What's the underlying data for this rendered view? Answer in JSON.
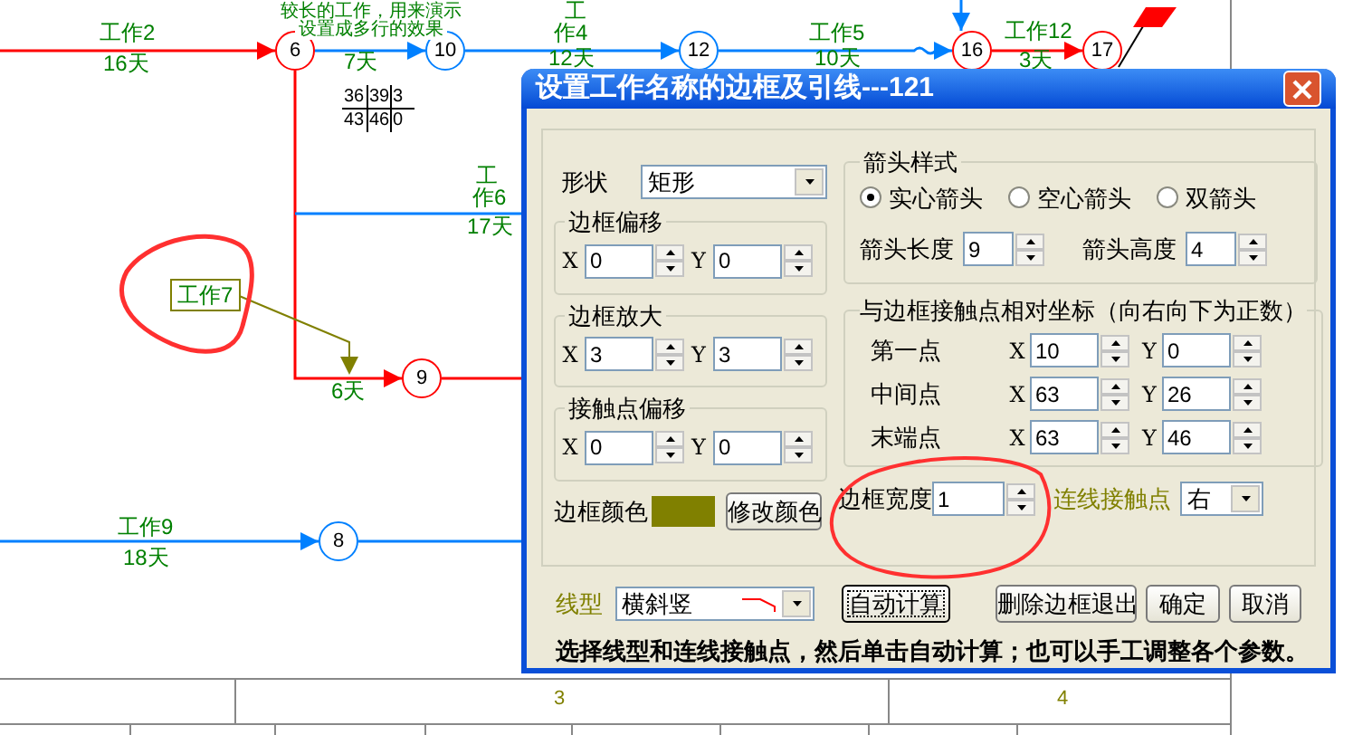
{
  "canvas": {
    "caption": [
      "较长的工作，用来演示",
      "设置成多行的效果"
    ],
    "nodes": [
      {
        "label": "6",
        "color": "#ff0000"
      },
      {
        "label": "10",
        "color": "#0080ff"
      },
      {
        "label": "12",
        "color": "#0080ff"
      },
      {
        "label": "16",
        "color": "#ff0000"
      },
      {
        "label": "17",
        "color": "#ff0000"
      },
      {
        "label": "9",
        "color": "#ff0000"
      },
      {
        "label": "8",
        "color": "#0080ff"
      }
    ],
    "labels": [
      "工作2",
      "16天",
      "7天",
      "工",
      "作4",
      "12天",
      "工作5",
      "10天",
      "工作12",
      "3天",
      "工",
      "作6",
      "17天",
      "6天",
      "工作9",
      "18天"
    ],
    "boxed_label": "工作7",
    "time_table": [
      [
        "36",
        "39",
        "3"
      ],
      [
        "43",
        "46",
        "0"
      ]
    ],
    "ruler": [
      "3",
      "4"
    ]
  },
  "dialog": {
    "title": "设置工作名称的边框及引线---121",
    "shape": {
      "label": "形状",
      "value": "矩形"
    },
    "offset_groups": [
      {
        "title": "边框偏移",
        "fields": [
          {
            "axis": "X",
            "value": "0"
          },
          {
            "axis": "Y",
            "value": "0"
          }
        ]
      },
      {
        "title": "边框放大",
        "fields": [
          {
            "axis": "X",
            "value": "3"
          },
          {
            "axis": "Y",
            "value": "3"
          }
        ]
      },
      {
        "title": "接触点偏移",
        "fields": [
          {
            "axis": "X",
            "value": "0"
          },
          {
            "axis": "Y",
            "value": "0"
          }
        ]
      }
    ],
    "border_color": {
      "label": "边框颜色",
      "color": "#808000",
      "button": "修改颜色"
    },
    "arrow_style": {
      "title": "箭头样式",
      "options": [
        {
          "label": "实心箭头",
          "selected": true
        },
        {
          "label": "空心箭头",
          "selected": false
        },
        {
          "label": "双箭头",
          "selected": false
        }
      ],
      "length": {
        "label": "箭头长度",
        "value": "9"
      },
      "height": {
        "label": "箭头高度",
        "value": "4"
      }
    },
    "coords": {
      "title": "与边框接触点相对坐标（向右向下为正数）",
      "points": [
        {
          "label": "第一点",
          "fields": [
            {
              "axis": "X",
              "value": "10"
            },
            {
              "axis": "Y",
              "value": "0"
            }
          ]
        },
        {
          "label": "中间点",
          "fields": [
            {
              "axis": "X",
              "value": "63"
            },
            {
              "axis": "Y",
              "value": "26"
            }
          ]
        },
        {
          "label": "末端点",
          "fields": [
            {
              "axis": "X",
              "value": "63"
            },
            {
              "axis": "Y",
              "value": "46"
            }
          ]
        }
      ]
    },
    "border_width": {
      "label": "边框宽度",
      "value": "1"
    },
    "contact": {
      "label": "连线接触点",
      "value": "右"
    },
    "line_type": {
      "label": "线型",
      "value": "横斜竖"
    },
    "buttons": [
      {
        "label": "自动计算",
        "focused": true
      },
      {
        "label": "删除边框退出",
        "focused": false
      },
      {
        "label": "确定",
        "focused": false
      },
      {
        "label": "取消",
        "focused": false
      }
    ],
    "note": "选择线型和连线接触点，然后单击自动计算；也可以手工调整各个参数。"
  }
}
